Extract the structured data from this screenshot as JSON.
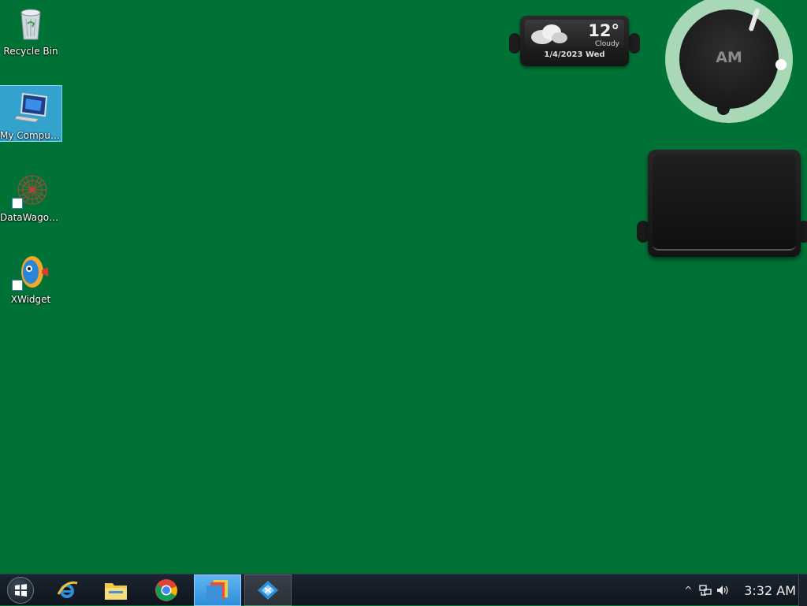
{
  "desktop": {
    "icons": [
      {
        "label": "Recycle Bin",
        "icon": "recycle-bin-icon"
      },
      {
        "label": "My Computer",
        "icon": "computer-icon",
        "selected": true
      },
      {
        "label": "DataWagon...",
        "icon": "datawagon-icon",
        "shortcut": true
      },
      {
        "label": "XWidget",
        "icon": "xwidget-icon",
        "shortcut": true
      }
    ],
    "background_color": "#007236"
  },
  "weather_widget": {
    "temperature": "12°",
    "condition": "Cloudy",
    "date": "1/4/2023 Wed"
  },
  "clock_widget": {
    "period": "AM"
  },
  "taskbar": {
    "apps": [
      {
        "name": "internet-explorer-icon"
      },
      {
        "name": "file-explorer-icon"
      },
      {
        "name": "chrome-icon"
      },
      {
        "name": "windows-explorer-icon",
        "active": true
      },
      {
        "name": "xwidget-taskbar-icon",
        "opened": true
      }
    ],
    "tray": {
      "chevron": "^",
      "time": "3:32 AM"
    }
  }
}
